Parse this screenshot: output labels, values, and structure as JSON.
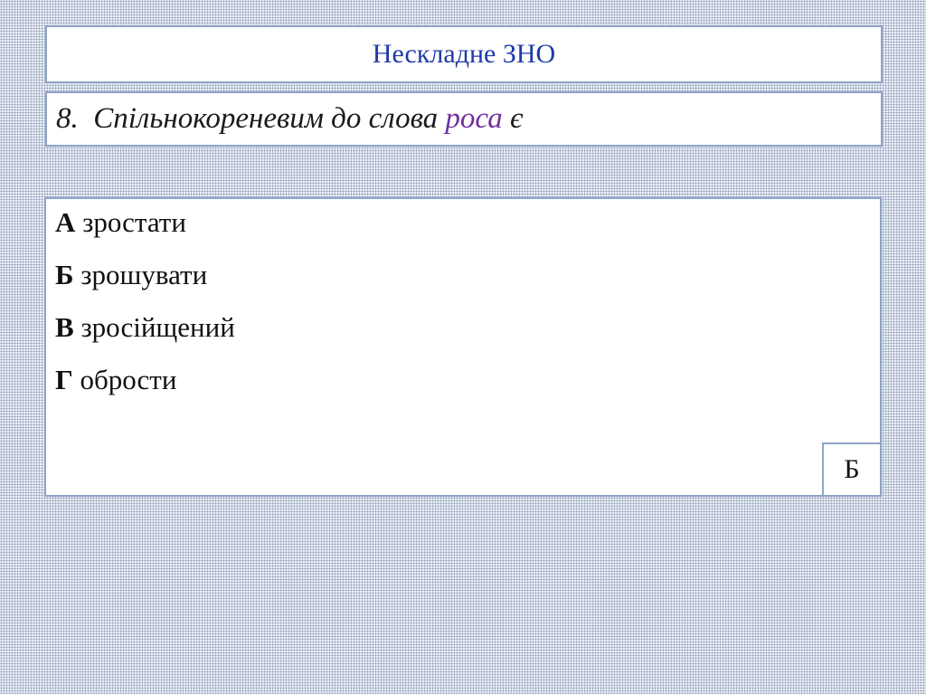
{
  "title": "Нескладне ЗНО",
  "question": {
    "number": "8.",
    "text_before": "Спільнокореневим до слова",
    "highlight": "роса",
    "text_after": "є",
    "highlight_color": "#7030a0"
  },
  "options": [
    {
      "letter": "А",
      "text": "зростати"
    },
    {
      "letter": "Б",
      "text": "зрошувати"
    },
    {
      "letter": "В",
      "text": "зросійщений"
    },
    {
      "letter": "Г",
      "text": "обрости"
    }
  ],
  "answer": "Б",
  "colors": {
    "title": "#1f3aa8",
    "border": "#8ea4c8"
  }
}
